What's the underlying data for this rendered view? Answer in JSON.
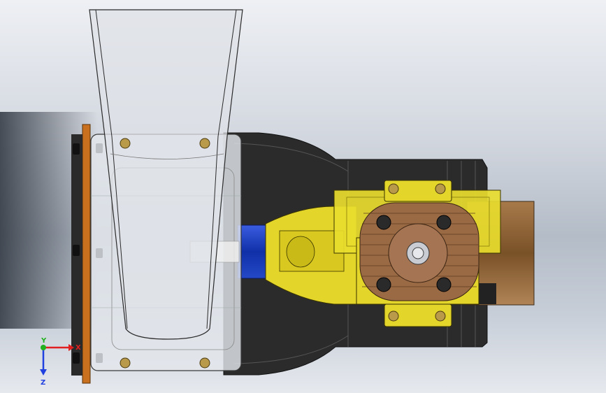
{
  "window": {
    "title": ""
  },
  "viewport": {
    "background_top": "#eef0f4",
    "background_mid": "#b4bcc7",
    "model_colors": {
      "hopper": "#d9dde3",
      "hopper_edge": "#2a2a2a",
      "housing": "#2b2b2b",
      "flange": "#c8701e",
      "adapter": "#e3d52a",
      "shaft": "#1e3fbf",
      "motor": "#8b6238",
      "gear_cover": "#9a6a45"
    }
  },
  "triad": {
    "x_label": "X",
    "y_label": "Y",
    "z_label": "Z",
    "x_color": "#e02020",
    "y_color": "#20b020",
    "z_color": "#2040e0"
  }
}
